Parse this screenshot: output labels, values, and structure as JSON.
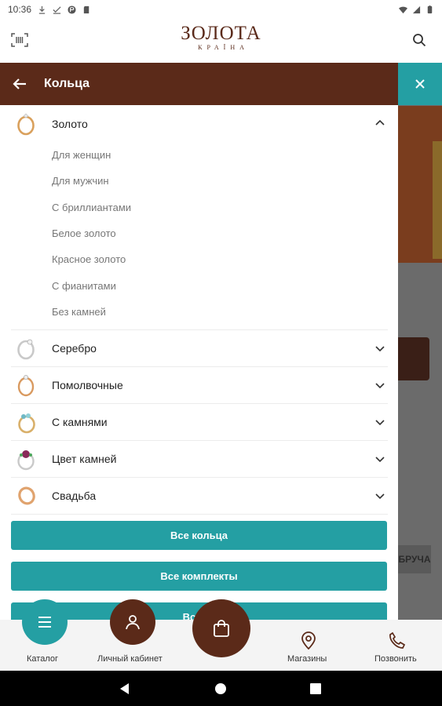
{
  "status_bar": {
    "time": "10:36"
  },
  "header": {
    "logo_main": "ЗОЛОТА",
    "logo_sub": "КРАЇНА"
  },
  "drawer": {
    "title": "Кольца",
    "categories": [
      {
        "label": "Золото",
        "expanded": true,
        "icon": "gold-ring-icon"
      },
      {
        "label": "Серебро",
        "expanded": false,
        "icon": "silver-ring-icon"
      },
      {
        "label": "Помолвочные",
        "expanded": false,
        "icon": "engagement-ring-icon"
      },
      {
        "label": "С камнями",
        "expanded": false,
        "icon": "stone-ring-icon"
      },
      {
        "label": "Цвет камней",
        "expanded": false,
        "icon": "gem-color-ring-icon"
      },
      {
        "label": "Свадьба",
        "expanded": false,
        "icon": "wedding-ring-icon"
      }
    ],
    "gold_subitems": [
      "Для женщин",
      "Для мужчин",
      "С бриллиантами",
      "Белое золото",
      "Красное золото",
      "С фианитами",
      "Без камней"
    ],
    "buttons": [
      "Все кольца",
      "Все комплекты",
      "Все ко"
    ]
  },
  "background": {
    "partial_label": "БРУЧА"
  },
  "bottom_nav": {
    "catalog": "Каталог",
    "account": "Личный кабинет",
    "stores": "Магазины",
    "call": "Позвонить"
  },
  "colors": {
    "brown": "#5b2a19",
    "teal": "#249fa3"
  }
}
